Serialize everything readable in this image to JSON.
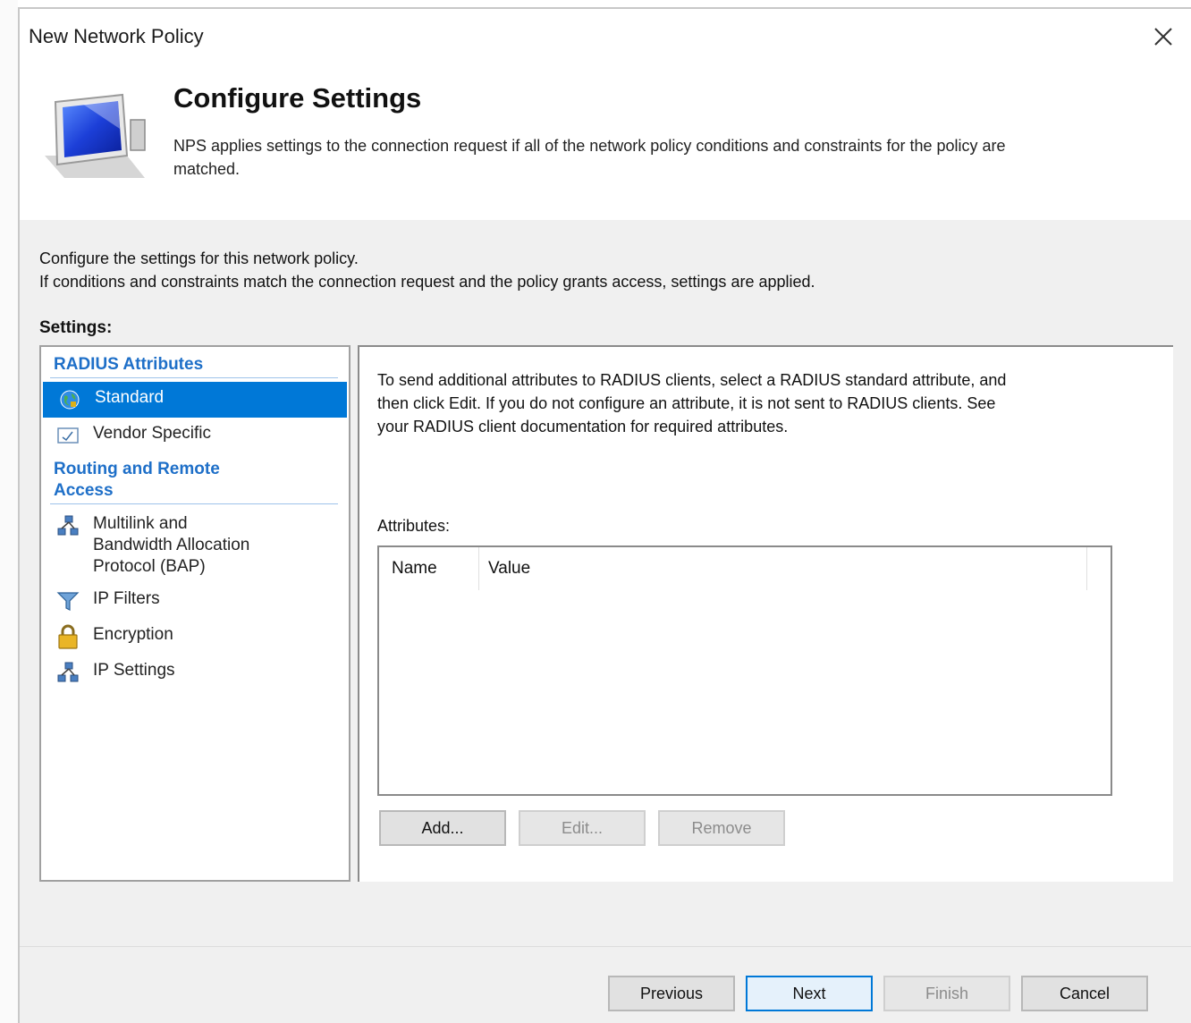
{
  "window": {
    "title": "New Network Policy",
    "close_icon": "close-icon"
  },
  "header": {
    "title": "Configure Settings",
    "description_line1": "NPS applies settings to the connection request if all of the network policy conditions and constraints for the policy are",
    "description_line2": "matched.",
    "icon": "computer-monitor-icon"
  },
  "intro": {
    "line1": "Configure the settings for this network policy.",
    "line2": "If conditions and constraints match the connection request and the policy grants access, settings are applied."
  },
  "settings_label": "Settings:",
  "nav": {
    "groups": [
      {
        "label": "RADIUS Attributes",
        "items": [
          {
            "label": "Standard",
            "icon": "globe-icon",
            "selected": true
          },
          {
            "label": "Vendor Specific",
            "icon": "vendor-icon",
            "selected": false
          }
        ]
      },
      {
        "label_line1": "Routing and Remote",
        "label_line2": "Access",
        "items": [
          {
            "label_line1": "Multilink and",
            "label_line2": "Bandwidth Allocation",
            "label_line3": "Protocol (BAP)",
            "icon": "network-icon"
          },
          {
            "label": "IP Filters",
            "icon": "filter-icon"
          },
          {
            "label": "Encryption",
            "icon": "lock-icon"
          },
          {
            "label": "IP Settings",
            "icon": "network-icon"
          }
        ]
      }
    ]
  },
  "panel": {
    "desc_line1": "To send additional attributes to RADIUS clients, select a RADIUS standard attribute, and",
    "desc_line2": "then click Edit. If you do not configure an attribute, it is not sent to RADIUS clients. See",
    "desc_line3": "your RADIUS client documentation for required attributes.",
    "attributes_label": "Attributes:",
    "columns": [
      "Name",
      "Value"
    ],
    "rows": [],
    "buttons": {
      "add": "Add...",
      "edit": "Edit...",
      "remove": "Remove"
    }
  },
  "footer": {
    "previous": "Previous",
    "next": "Next",
    "finish": "Finish",
    "cancel": "Cancel"
  },
  "colors": {
    "accent": "#0078d7",
    "group_heading": "#1e6fc8",
    "dialog_bg": "#f0f0f0"
  }
}
